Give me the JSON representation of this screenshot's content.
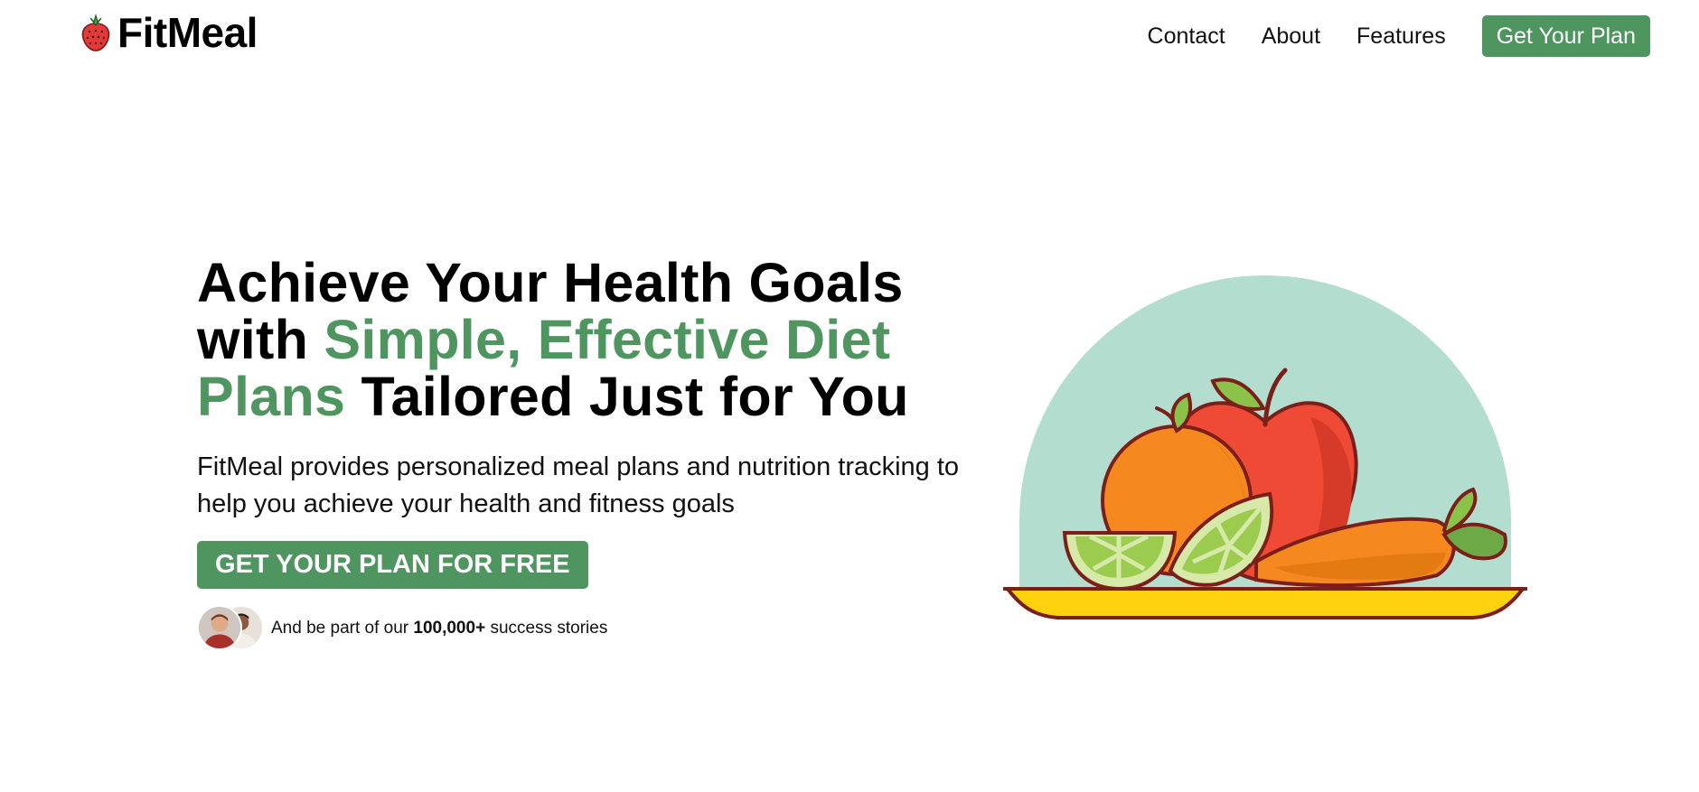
{
  "brand": {
    "name": "FitMeal",
    "icon": "strawberry-icon"
  },
  "nav": {
    "links": [
      "Contact",
      "About",
      "Features"
    ],
    "cta_label": "Get Your Plan"
  },
  "hero": {
    "headline_part1": "Achieve Your Health Goals with ",
    "headline_accent": "Simple, Effective Diet Plans",
    "headline_part2": " Tailored Just for You",
    "subtext": "FitMeal provides personalized meal plans and nutrition tracking to help you achieve your health and fitness goals",
    "cta_label": "GET YOUR PLAN FOR FREE",
    "social_prefix": "And be part of our ",
    "social_count": "100,000+",
    "social_suffix": " success stories"
  },
  "colors": {
    "accent": "#4f9560",
    "circle": "#b2ddcf",
    "plate": "#f5c518"
  }
}
